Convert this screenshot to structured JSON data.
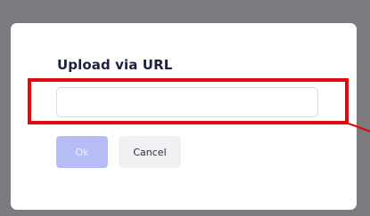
{
  "dialog": {
    "title": "Upload via URL",
    "url_input": {
      "value": "",
      "placeholder": ""
    },
    "buttons": {
      "ok_label": "Ok",
      "cancel_label": "Cancel"
    }
  },
  "colors": {
    "backdrop": "#7c7c80",
    "dialog_background": "#ffffff",
    "title_text": "#1e2140",
    "ok_button_disabled": "#b6bdf6",
    "cancel_button": "#f1f1f3",
    "highlight_annotation": "#e3080c"
  }
}
